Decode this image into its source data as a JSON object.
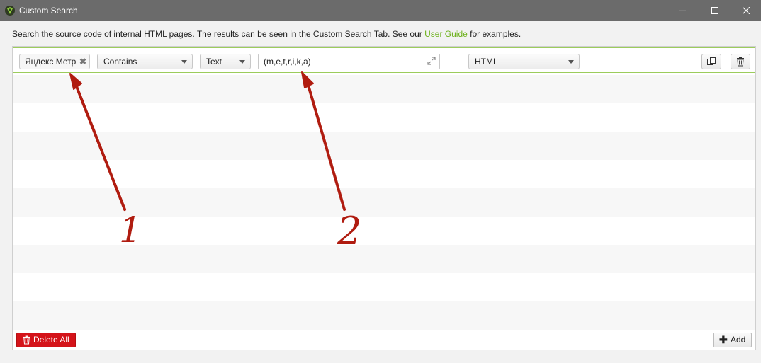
{
  "window": {
    "title": "Custom Search",
    "controls": [
      "minimize",
      "maximize",
      "close"
    ]
  },
  "intro": {
    "text_before": "Search the source code of internal HTML pages. The results can be seen in the Custom Search Tab. See our ",
    "link": "User Guide",
    "text_after": " for examples."
  },
  "rule": {
    "tag_label": "Яндекс Метр",
    "match_type": "Contains",
    "mode": "Text",
    "query": "(m,e,t,r,i,k,a)",
    "scope": "HTML"
  },
  "annotations": [
    "1",
    "2"
  ],
  "footer": {
    "delete_all_label": "Delete All",
    "add_label": "Add"
  },
  "colors": {
    "accent_green": "#6fb21f",
    "row_border": "#9ccc5c",
    "danger": "#d4141a",
    "annotation": "#b01c10",
    "titlebar": "#6b6b6b"
  }
}
